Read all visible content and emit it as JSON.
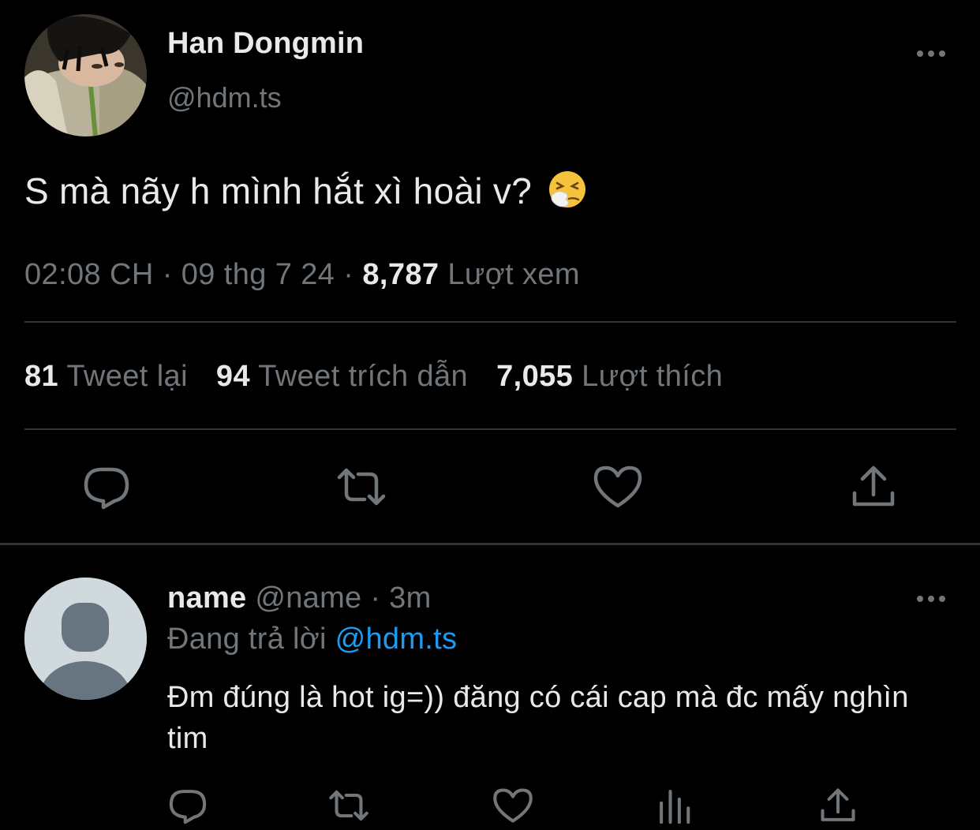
{
  "tweet": {
    "author": {
      "display_name": "Han Dongmin",
      "handle": "@hdm.ts",
      "avatar": "profile-photo"
    },
    "text": "S mà nãy h mình hắt xì hoài v?",
    "emoji": "sneezing-face-emoji",
    "time": "02:08 CH",
    "separator": "·",
    "date": "09 thg 7 24",
    "views_count": "8,787",
    "views_label": "Lượt xem",
    "stats": {
      "retweets_count": "81",
      "retweets_label": "Tweet lại",
      "quotes_count": "94",
      "quotes_label": "Tweet trích dẫn",
      "likes_count": "7,055",
      "likes_label": "Lượt thích"
    },
    "actions": [
      "reply-icon",
      "retweet-icon",
      "like-icon",
      "share-icon"
    ]
  },
  "reply": {
    "display_name": "name",
    "handle": "@name",
    "separator": "·",
    "time": "3m",
    "replying_label": "Đang trả lời",
    "replying_to": "@hdm.ts",
    "text": "Đm đúng là hot ig=)) đăng có cái cap mà đc mấy nghìn tim",
    "actions": [
      "reply-icon",
      "retweet-icon",
      "like-icon",
      "analytics-icon",
      "share-icon"
    ]
  },
  "colors": {
    "background": "#000000",
    "text_primary": "#e7e9ea",
    "text_secondary": "#71767b",
    "accent": "#1d9bf0",
    "divider": "#2f3336"
  }
}
